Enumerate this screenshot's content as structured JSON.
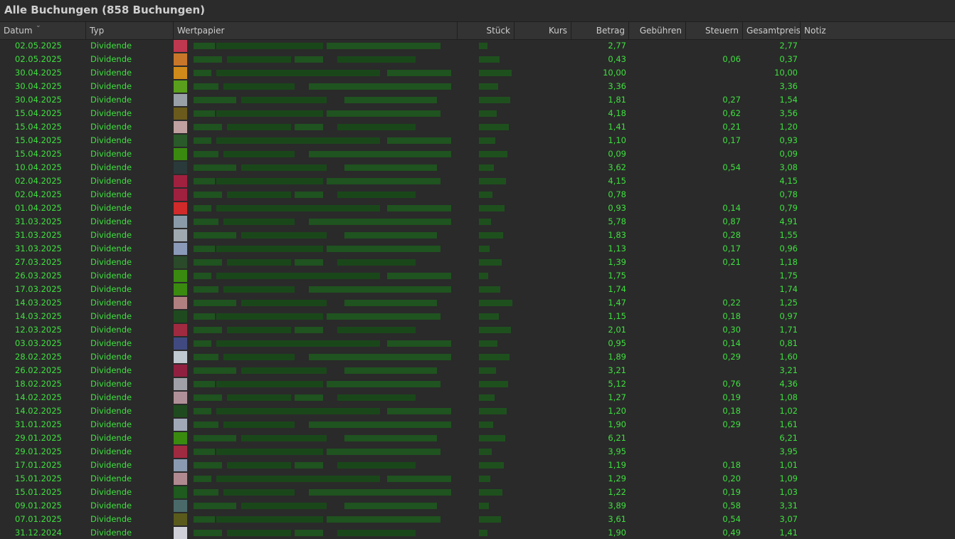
{
  "title": "Alle Buchungen (858 Buchungen)",
  "columns": {
    "datum": "Datum",
    "typ": "Typ",
    "wertpapier": "Wertpapier",
    "stueck": "Stück",
    "kurs": "Kurs",
    "betrag": "Betrag",
    "gebuehren": "Gebühren",
    "steuern": "Steuern",
    "gesamtpreis": "Gesamtpreis",
    "notiz": "Notiz"
  },
  "icons": {
    "sort": "chevron-down-icon"
  },
  "colors": {
    "text": "#3fe03f",
    "background": "#2a2a2a",
    "header": "#333333"
  },
  "rows": [
    {
      "date": "02.05.2025",
      "type": "Dividende",
      "betrag": "2,77",
      "steuern": "",
      "total": "2,77",
      "logo": "#c0384f"
    },
    {
      "date": "02.05.2025",
      "type": "Dividende",
      "betrag": "0,43",
      "steuern": "0,06",
      "total": "0,37",
      "logo": "#c8762a"
    },
    {
      "date": "30.04.2025",
      "type": "Dividende",
      "betrag": "10,00",
      "steuern": "",
      "total": "10,00",
      "logo": "#d08a1a"
    },
    {
      "date": "30.04.2025",
      "type": "Dividende",
      "betrag": "3,36",
      "steuern": "",
      "total": "3,36",
      "logo": "#5aa01c"
    },
    {
      "date": "30.04.2025",
      "type": "Dividende",
      "betrag": "1,81",
      "steuern": "0,27",
      "total": "1,54",
      "logo": "#9aa0a8"
    },
    {
      "date": "15.04.2025",
      "type": "Dividende",
      "betrag": "4,18",
      "steuern": "0,62",
      "total": "3,56",
      "logo": "#6a5a1c"
    },
    {
      "date": "15.04.2025",
      "type": "Dividende",
      "betrag": "1,41",
      "steuern": "0,21",
      "total": "1,20",
      "logo": "#c0a0a0"
    },
    {
      "date": "15.04.2025",
      "type": "Dividende",
      "betrag": "1,10",
      "steuern": "0,17",
      "total": "0,93",
      "logo": "#2a5a2a"
    },
    {
      "date": "15.04.2025",
      "type": "Dividende",
      "betrag": "0,09",
      "steuern": "",
      "total": "0,09",
      "logo": "#3a8a10"
    },
    {
      "date": "10.04.2025",
      "type": "Dividende",
      "betrag": "3,62",
      "steuern": "0,54",
      "total": "3,08",
      "logo": "#2a3a3a"
    },
    {
      "date": "02.04.2025",
      "type": "Dividende",
      "betrag": "4,15",
      "steuern": "",
      "total": "4,15",
      "logo": "#a02040"
    },
    {
      "date": "02.04.2025",
      "type": "Dividende",
      "betrag": "0,78",
      "steuern": "",
      "total": "0,78",
      "logo": "#a02040"
    },
    {
      "date": "01.04.2025",
      "type": "Dividende",
      "betrag": "0,93",
      "steuern": "0,14",
      "total": "0,79",
      "logo": "#d02a2a"
    },
    {
      "date": "31.03.2025",
      "type": "Dividende",
      "betrag": "5,78",
      "steuern": "0,87",
      "total": "4,91",
      "logo": "#8a9aa8"
    },
    {
      "date": "31.03.2025",
      "type": "Dividende",
      "betrag": "1,83",
      "steuern": "0,28",
      "total": "1,55",
      "logo": "#a0a8b0"
    },
    {
      "date": "31.03.2025",
      "type": "Dividende",
      "betrag": "1,13",
      "steuern": "0,17",
      "total": "0,96",
      "logo": "#8a9ab8"
    },
    {
      "date": "27.03.2025",
      "type": "Dividende",
      "betrag": "1,39",
      "steuern": "0,21",
      "total": "1,18",
      "logo": "#2a4a2a"
    },
    {
      "date": "26.03.2025",
      "type": "Dividende",
      "betrag": "1,75",
      "steuern": "",
      "total": "1,75",
      "logo": "#3a8a10"
    },
    {
      "date": "17.03.2025",
      "type": "Dividende",
      "betrag": "1,74",
      "steuern": "",
      "total": "1,74",
      "logo": "#3a8a10"
    },
    {
      "date": "14.03.2025",
      "type": "Dividende",
      "betrag": "1,47",
      "steuern": "0,22",
      "total": "1,25",
      "logo": "#b08080"
    },
    {
      "date": "14.03.2025",
      "type": "Dividende",
      "betrag": "1,15",
      "steuern": "0,18",
      "total": "0,97",
      "logo": "#1f4a1f"
    },
    {
      "date": "12.03.2025",
      "type": "Dividende",
      "betrag": "2,01",
      "steuern": "0,30",
      "total": "1,71",
      "logo": "#a02a40"
    },
    {
      "date": "03.03.2025",
      "type": "Dividende",
      "betrag": "0,95",
      "steuern": "0,14",
      "total": "0,81",
      "logo": "#404a80"
    },
    {
      "date": "28.02.2025",
      "type": "Dividende",
      "betrag": "1,89",
      "steuern": "0,29",
      "total": "1,60",
      "logo": "#c0c8d0"
    },
    {
      "date": "26.02.2025",
      "type": "Dividende",
      "betrag": "3,21",
      "steuern": "",
      "total": "3,21",
      "logo": "#902040"
    },
    {
      "date": "18.02.2025",
      "type": "Dividende",
      "betrag": "5,12",
      "steuern": "0,76",
      "total": "4,36",
      "logo": "#a0a0a8"
    },
    {
      "date": "14.02.2025",
      "type": "Dividende",
      "betrag": "1,27",
      "steuern": "0,19",
      "total": "1,08",
      "logo": "#b09098"
    },
    {
      "date": "14.02.2025",
      "type": "Dividende",
      "betrag": "1,20",
      "steuern": "0,18",
      "total": "1,02",
      "logo": "#1f4a1f"
    },
    {
      "date": "31.01.2025",
      "type": "Dividende",
      "betrag": "1,90",
      "steuern": "0,29",
      "total": "1,61",
      "logo": "#a0a8b8"
    },
    {
      "date": "29.01.2025",
      "type": "Dividende",
      "betrag": "6,21",
      "steuern": "",
      "total": "6,21",
      "logo": "#3a8a10"
    },
    {
      "date": "29.01.2025",
      "type": "Dividende",
      "betrag": "3,95",
      "steuern": "",
      "total": "3,95",
      "logo": "#a02a40"
    },
    {
      "date": "17.01.2025",
      "type": "Dividende",
      "betrag": "1,19",
      "steuern": "0,18",
      "total": "1,01",
      "logo": "#8a9ab0"
    },
    {
      "date": "15.01.2025",
      "type": "Dividende",
      "betrag": "1,29",
      "steuern": "0,20",
      "total": "1,09",
      "logo": "#b08a90"
    },
    {
      "date": "15.01.2025",
      "type": "Dividende",
      "betrag": "1,22",
      "steuern": "0,19",
      "total": "1,03",
      "logo": "#1f5a1f"
    },
    {
      "date": "09.01.2025",
      "type": "Dividende",
      "betrag": "3,89",
      "steuern": "0,58",
      "total": "3,31",
      "logo": "#4a6a6a"
    },
    {
      "date": "07.01.2025",
      "type": "Dividende",
      "betrag": "3,61",
      "steuern": "0,54",
      "total": "3,07",
      "logo": "#5a5a1c"
    },
    {
      "date": "31.12.2024",
      "type": "Dividende",
      "betrag": "1,90",
      "steuern": "0,49",
      "total": "1,41",
      "logo": "#d0d0d8"
    }
  ]
}
